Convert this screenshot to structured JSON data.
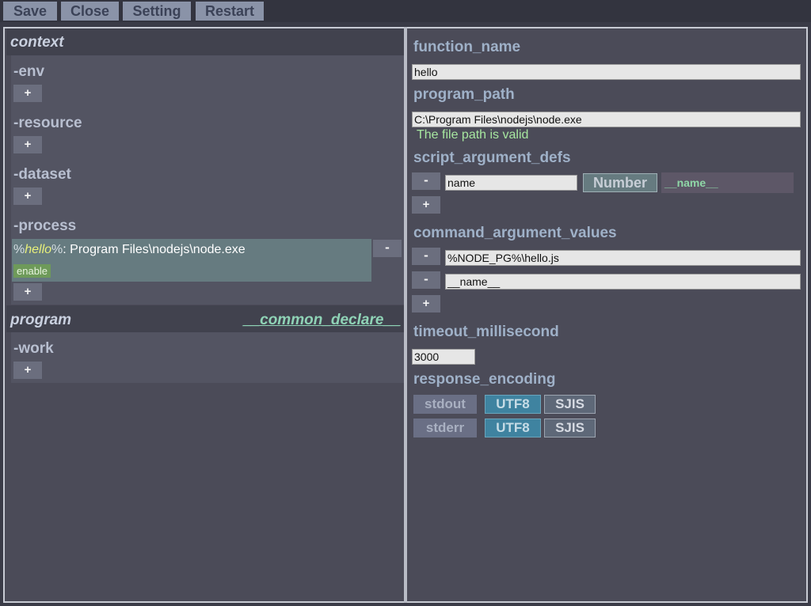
{
  "toolbar": {
    "save_label": "Save",
    "close_label": "Close",
    "setting_label": "Setting",
    "restart_label": "Restart"
  },
  "left": {
    "context_title": "context",
    "env_label": "-env",
    "resource_label": "-resource",
    "dataset_label": "-dataset",
    "process_label": "-process",
    "process_item": {
      "pct_open": "%",
      "name": "hello",
      "pct_close": "%",
      "path": ": Program Files\\nodejs\\node.exe",
      "badge": "enable"
    },
    "program_title": "program",
    "common_declare_link": "__common_declare__",
    "work_label": "-work",
    "add_symbol": "+",
    "remove_symbol": "-"
  },
  "right": {
    "function_name_label": "function_name",
    "function_name_value": "hello",
    "program_path_label": "program_path",
    "program_path_value": "C:\\Program Files\\nodejs\\node.exe",
    "program_path_status": "The file path is valid",
    "script_argument_defs_label": "script_argument_defs",
    "script_arg_name_value": "name",
    "script_arg_type": "Number",
    "script_arg_var": "__name__",
    "command_argument_values_label": "command_argument_values",
    "command_args": [
      "%NODE_PG%\\hello.js",
      "__name__"
    ],
    "timeout_label": "timeout_millisecond",
    "timeout_value": "3000",
    "response_encoding_label": "response_encoding",
    "encoding_rows": [
      {
        "stream": "stdout",
        "utf8": "UTF8",
        "sjis": "SJIS"
      },
      {
        "stream": "stderr",
        "utf8": "UTF8",
        "sjis": "SJIS"
      }
    ],
    "add_symbol": "+",
    "remove_symbol": "-"
  }
}
